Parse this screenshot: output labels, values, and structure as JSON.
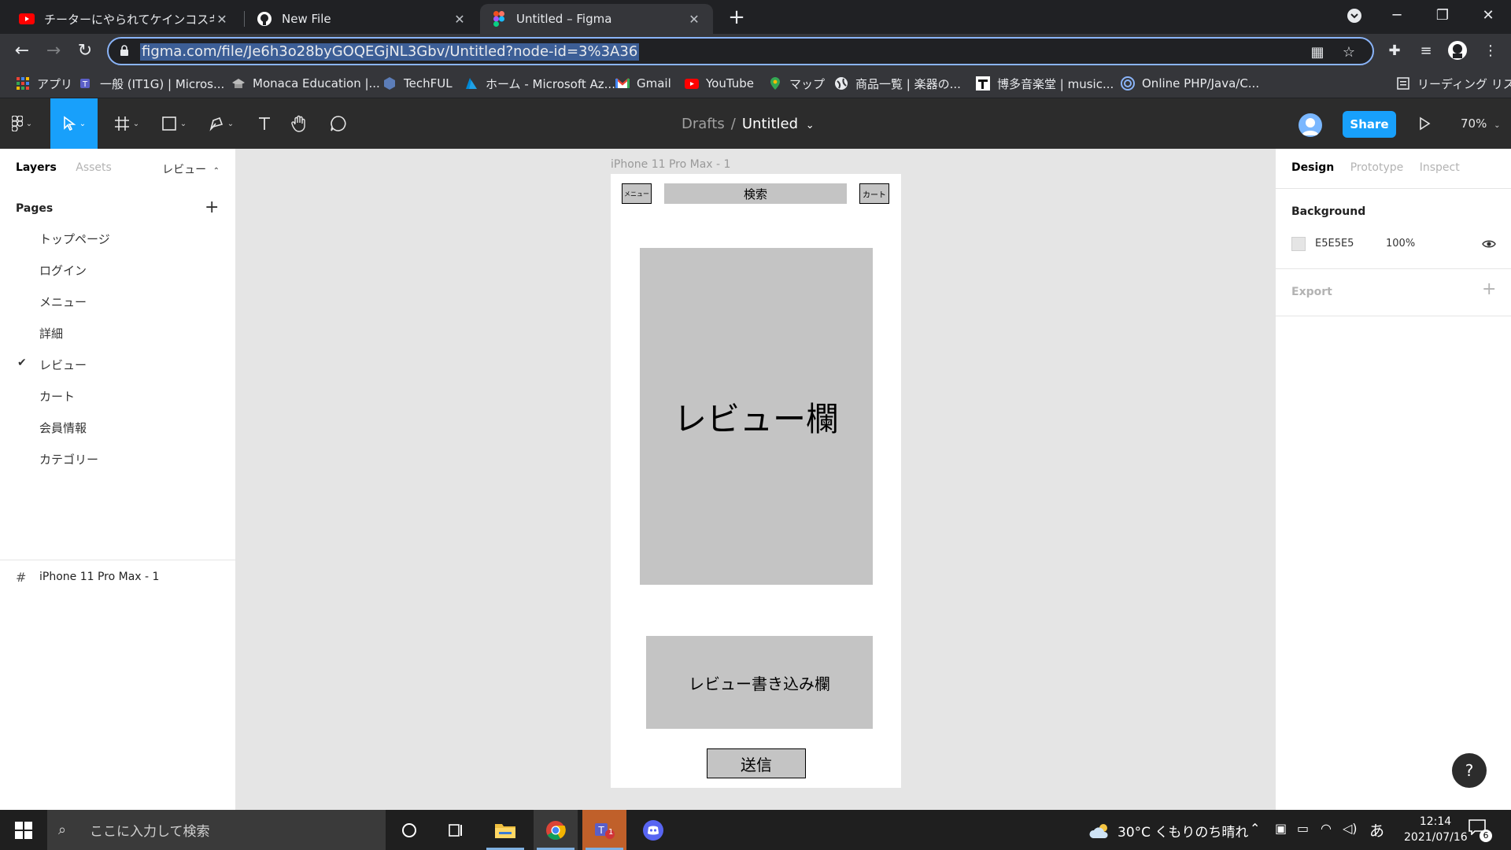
{
  "browser": {
    "tabs": [
      {
        "title": "チーターにやられてケインコスギと同じ末",
        "icon": "youtube-icon",
        "active": false
      },
      {
        "title": "New File",
        "icon": "github-icon",
        "active": false
      },
      {
        "title": "Untitled – Figma",
        "icon": "figma-icon",
        "active": true
      }
    ],
    "url": "figma.com/file/Je6h3o28byGOQEGjNL3Gbv/Untitled?node-id=3%3A36",
    "bookmarks": [
      {
        "label": "アプリ",
        "icon": "apps-grid-icon"
      },
      {
        "label": "一般 (IT1G) | Micros...",
        "icon": "teams-icon"
      },
      {
        "label": "Monaca Education |...",
        "icon": "monaca-icon"
      },
      {
        "label": "TechFUL",
        "icon": "techful-icon"
      },
      {
        "label": "ホーム - Microsoft Az...",
        "icon": "azure-icon"
      },
      {
        "label": "Gmail",
        "icon": "gmail-icon"
      },
      {
        "label": "YouTube",
        "icon": "youtube-icon"
      },
      {
        "label": "マップ",
        "icon": "maps-icon"
      },
      {
        "label": "商品一覧 | 楽器の...",
        "icon": "globe-icon"
      },
      {
        "label": "博多音楽堂 | music...",
        "icon": "hakata-icon"
      },
      {
        "label": "Online PHP/Java/C...",
        "icon": "online-ide-icon"
      }
    ],
    "reading_list": "リーディング リスト"
  },
  "figma": {
    "breadcrumb": {
      "folder": "Drafts",
      "file": "Untitled"
    },
    "share_label": "Share",
    "zoom": "70%",
    "left_panel": {
      "tab_layers": "Layers",
      "tab_assets": "Assets",
      "current_page": "レビュー",
      "pages_title": "Pages",
      "pages": [
        "トップページ",
        "ログイン",
        "メニュー",
        "詳細",
        "レビュー",
        "カート",
        "会員情報",
        "カテゴリー"
      ],
      "selected_page": "レビュー",
      "layer": "iPhone 11 Pro Max - 1"
    },
    "canvas": {
      "frame_label": "iPhone 11 Pro Max - 1",
      "menu_btn": "メニュー",
      "search_bar": "検索",
      "cart_btn": "カート",
      "review_area": "レビュー欄",
      "review_input": "レビュー書き込み欄",
      "submit_btn": "送信"
    },
    "right_panel": {
      "tab_design": "Design",
      "tab_prototype": "Prototype",
      "tab_inspect": "Inspect",
      "background_title": "Background",
      "background_hex": "E5E5E5",
      "background_opacity": "100%",
      "export_title": "Export"
    },
    "help": "?"
  },
  "taskbar": {
    "search_placeholder": "ここに入力して検索",
    "weather": "30°C くもりのち晴れ",
    "ime": "あ",
    "time": "12:14",
    "date": "2021/07/16",
    "notification_count": "6",
    "teams_badge": "1"
  },
  "colors": {
    "figma_blue": "#18A0FB",
    "canvas_bg": "#E5E5E5",
    "wireframe_gray": "#C4C4C4"
  }
}
